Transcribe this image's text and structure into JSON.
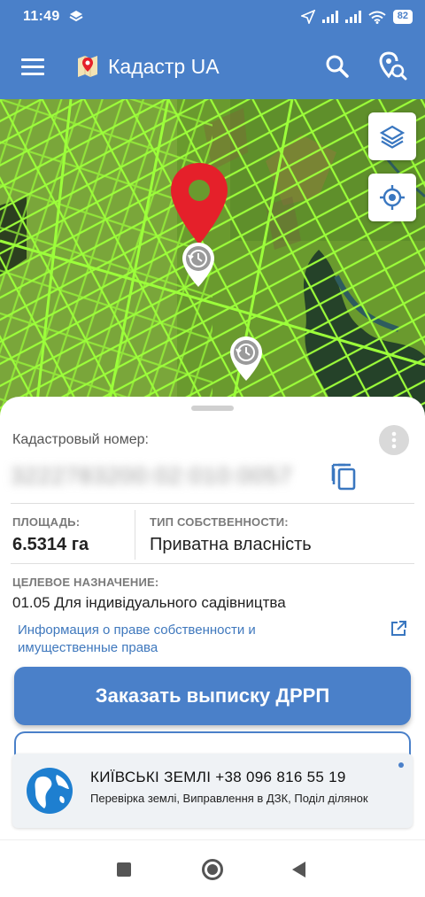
{
  "status_bar": {
    "time": "11:49",
    "battery": "82"
  },
  "app_bar": {
    "title": "Кадастр UA",
    "menu_icon": "hamburger-menu-icon",
    "search_icon": "search-icon",
    "pin_search_icon": "location-search-icon"
  },
  "map": {
    "layers_icon": "layers-icon",
    "locate_icon": "crosshair-icon",
    "selected_pin_color": "#e5202a",
    "history_pin_icon": "history-pin-icon",
    "parcel_outline_color": "#9cff3a"
  },
  "sheet": {
    "cadastral_label": "Кадастровый номер:",
    "cadastral_number": "3222783200:02:010:0057",
    "area_label": "ПЛОЩАДЬ:",
    "area_value": "6.5314 га",
    "ownership_label": "ТИП СОБСТВЕННОСТИ:",
    "ownership_value": "Приватна власність",
    "purpose_label": "ЦЕЛЕВОЕ НАЗНАЧЕНИЕ:",
    "purpose_value": "01.05 Для індивідуального садівництва",
    "rights_link": "Информация о праве собственности и имущественные права",
    "order_button": "Заказать выписку ДРРП"
  },
  "ad": {
    "title": "КИЇВСЬКІ ЗЕМЛІ +38 096 816 55 19",
    "text": "Перевірка землі, Виправлення в ДЗК, Поділ ділянок",
    "icon": "globe-icon"
  },
  "colors": {
    "primary": "#4a80c9",
    "link": "#3f78bd"
  }
}
